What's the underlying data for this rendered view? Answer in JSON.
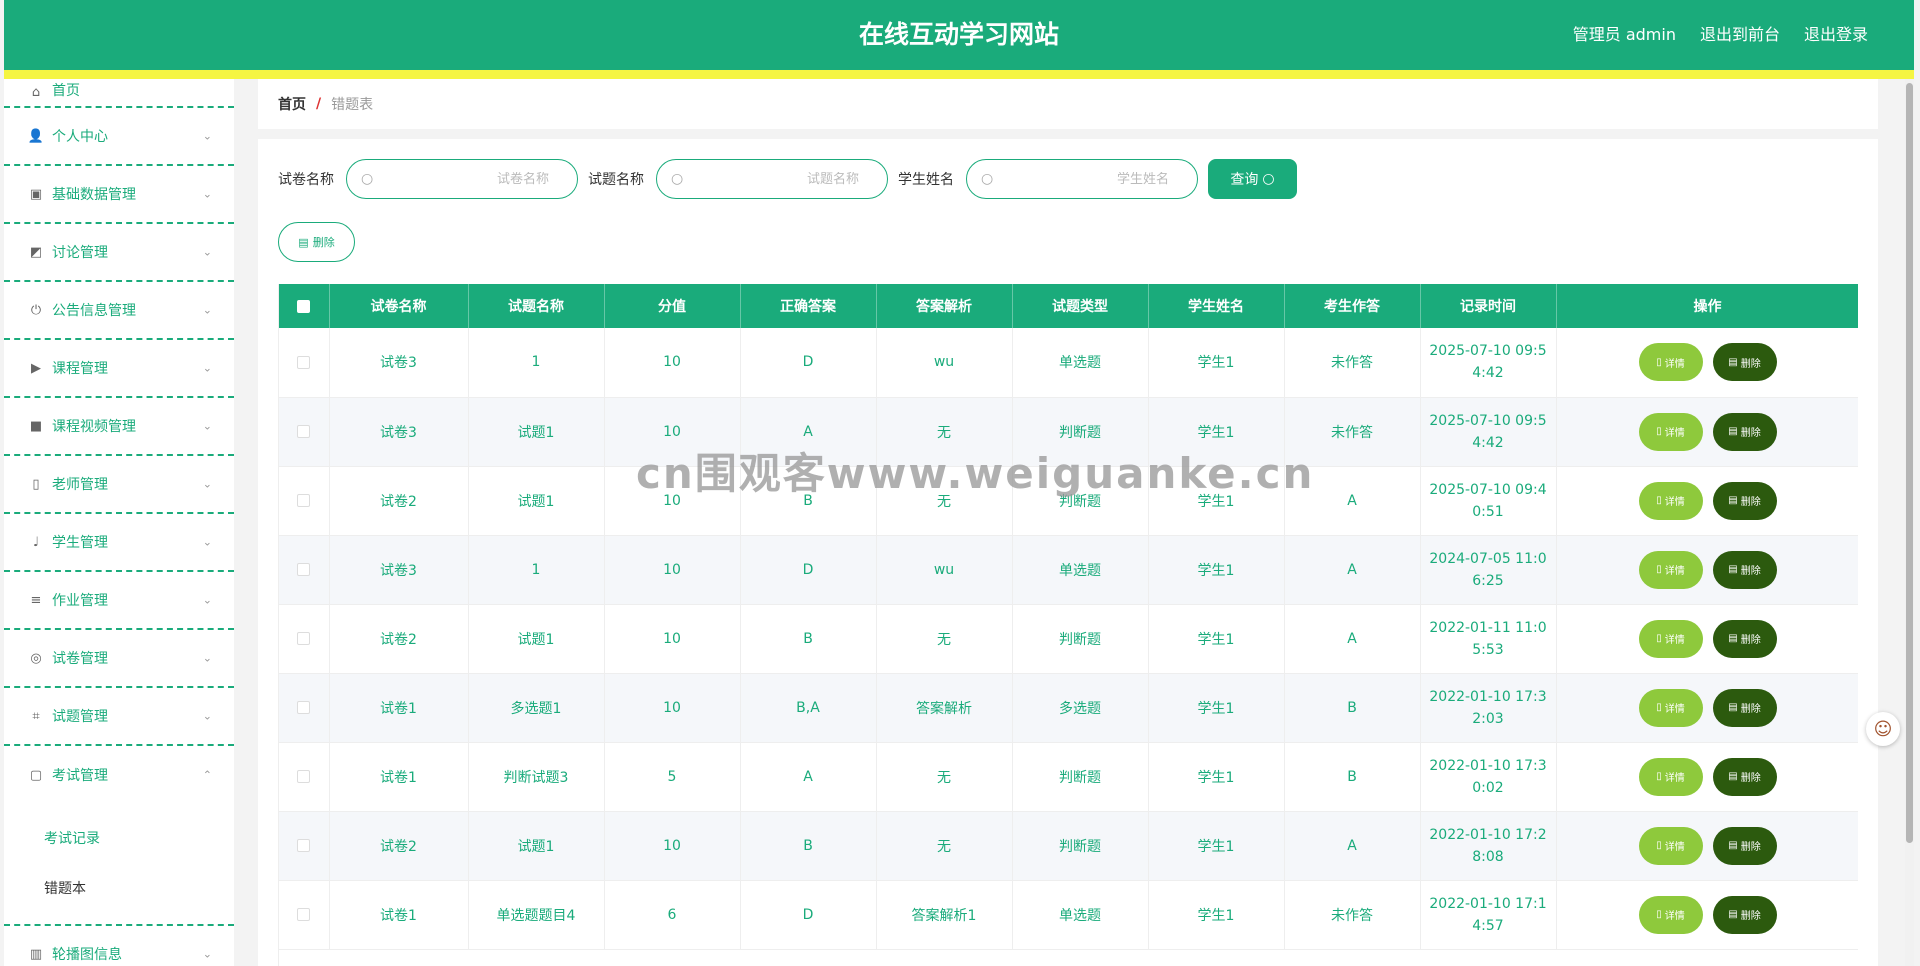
{
  "header": {
    "title": "在线互动学习网站",
    "user": "管理员 admin",
    "to_front": "退出到前台",
    "logout": "退出登录"
  },
  "sidebar": {
    "items": [
      {
        "label": "首页",
        "icon": "home-icon"
      },
      {
        "label": "个人中心",
        "icon": "user-icon"
      },
      {
        "label": "基础数据管理",
        "icon": "clipboard-icon"
      },
      {
        "label": "讨论管理",
        "icon": "chart-icon"
      },
      {
        "label": "公告信息管理",
        "icon": "power-icon"
      },
      {
        "label": "课程管理",
        "icon": "video-camera-icon"
      },
      {
        "label": "课程视频管理",
        "icon": "camera-icon"
      },
      {
        "label": "老师管理",
        "icon": "phone-icon"
      },
      {
        "label": "学生管理",
        "icon": "microphone-icon"
      },
      {
        "label": "作业管理",
        "icon": "list-icon"
      },
      {
        "label": "试卷管理",
        "icon": "target-icon"
      },
      {
        "label": "试题管理",
        "icon": "crop-icon"
      },
      {
        "label": "考试管理",
        "icon": "message-icon"
      }
    ],
    "sub_items": [
      "考试记录",
      "错题本"
    ],
    "last_item": {
      "label": "轮播图信息",
      "icon": "books-icon"
    }
  },
  "breadcrumb": {
    "home": "首页",
    "separator": "/",
    "current": "错题表"
  },
  "search": {
    "paper_label": "试卷名称",
    "paper_placeholder": "试卷名称",
    "question_label": "试题名称",
    "question_placeholder": "试题名称",
    "student_label": "学生姓名",
    "student_placeholder": "学生姓名",
    "query_button": "查询"
  },
  "toolbar": {
    "delete_label": "删除"
  },
  "table": {
    "columns": [
      "试卷名称",
      "试题名称",
      "分值",
      "正确答案",
      "答案解析",
      "试题类型",
      "学生姓名",
      "考生作答",
      "记录时间",
      "操作"
    ],
    "detail_label": "详情",
    "delete_label": "删除",
    "rows": [
      {
        "paper": "试卷3",
        "question": "1",
        "score": "10",
        "answer": "D",
        "analysis": "wu",
        "type": "单选题",
        "student": "学生1",
        "response": "未作答",
        "time": "2025-07-10 09:5\n4:42"
      },
      {
        "paper": "试卷3",
        "question": "试题1",
        "score": "10",
        "answer": "A",
        "analysis": "无",
        "type": "判断题",
        "student": "学生1",
        "response": "未作答",
        "time": "2025-07-10 09:5\n4:42"
      },
      {
        "paper": "试卷2",
        "question": "试题1",
        "score": "10",
        "answer": "B",
        "analysis": "无",
        "type": "判断题",
        "student": "学生1",
        "response": "A",
        "time": "2025-07-10 09:4\n0:51"
      },
      {
        "paper": "试卷3",
        "question": "1",
        "score": "10",
        "answer": "D",
        "analysis": "wu",
        "type": "单选题",
        "student": "学生1",
        "response": "A",
        "time": "2024-07-05 11:0\n6:25"
      },
      {
        "paper": "试卷2",
        "question": "试题1",
        "score": "10",
        "answer": "B",
        "analysis": "无",
        "type": "判断题",
        "student": "学生1",
        "response": "A",
        "time": "2022-01-11 11:0\n5:53"
      },
      {
        "paper": "试卷1",
        "question": "多选题1",
        "score": "10",
        "answer": "B,A",
        "analysis": "答案解析",
        "type": "多选题",
        "student": "学生1",
        "response": "B",
        "time": "2022-01-10 17:3\n2:03"
      },
      {
        "paper": "试卷1",
        "question": "判断试题3",
        "score": "5",
        "answer": "A",
        "analysis": "无",
        "type": "判断题",
        "student": "学生1",
        "response": "B",
        "time": "2022-01-10 17:3\n0:02"
      },
      {
        "paper": "试卷2",
        "question": "试题1",
        "score": "10",
        "answer": "B",
        "analysis": "无",
        "type": "判断题",
        "student": "学生1",
        "response": "A",
        "time": "2022-01-10 17:2\n8:08"
      },
      {
        "paper": "试卷1",
        "question": "单选题题目4",
        "score": "6",
        "answer": "D",
        "analysis": "答案解析1",
        "type": "单选题",
        "student": "学生1",
        "response": "未作答",
        "time": "2022-01-10 17:1\n4:57"
      }
    ]
  },
  "watermark": "cn围观客www.weiguanke.cn",
  "colors": {
    "primary": "#1aab7b",
    "accent_yellow": "#f5f542",
    "detail_button": "#8ec93c",
    "delete_button": "#2c5a0e"
  }
}
